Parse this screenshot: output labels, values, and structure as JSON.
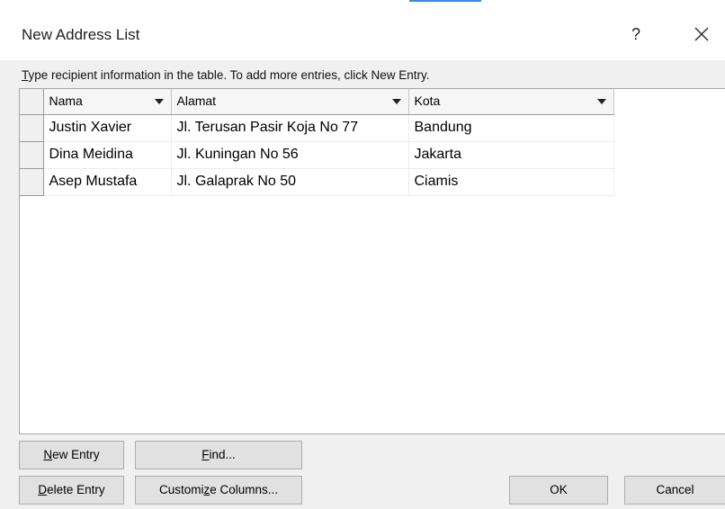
{
  "window": {
    "title": "New Address List",
    "help_label": "?"
  },
  "instruction": {
    "accel": "T",
    "rest": "ype recipient information in the table.  To add more entries, click New Entry."
  },
  "table": {
    "columns": [
      {
        "label": "Nama"
      },
      {
        "label": "Alamat"
      },
      {
        "label": "Kota"
      }
    ],
    "rows": [
      {
        "nama": "Justin Xavier",
        "alamat": "Jl. Terusan Pasir Koja No 77",
        "kota": "Bandung"
      },
      {
        "nama": "Dina Meidina",
        "alamat": "Jl. Kuningan No 56",
        "kota": "Jakarta"
      },
      {
        "nama": "Asep Mustafa",
        "alamat": "Jl. Galaprak No 50",
        "kota": "Ciamis"
      }
    ]
  },
  "buttons": {
    "new_entry": {
      "accel": "N",
      "rest": "ew Entry"
    },
    "find": {
      "accel": "F",
      "rest": "ind..."
    },
    "delete_entry": {
      "accel": "D",
      "rest": "elete Entry"
    },
    "customize": {
      "before": "Customi",
      "accel": "z",
      "after": "e Columns..."
    },
    "ok": "OK",
    "cancel": "Cancel"
  }
}
